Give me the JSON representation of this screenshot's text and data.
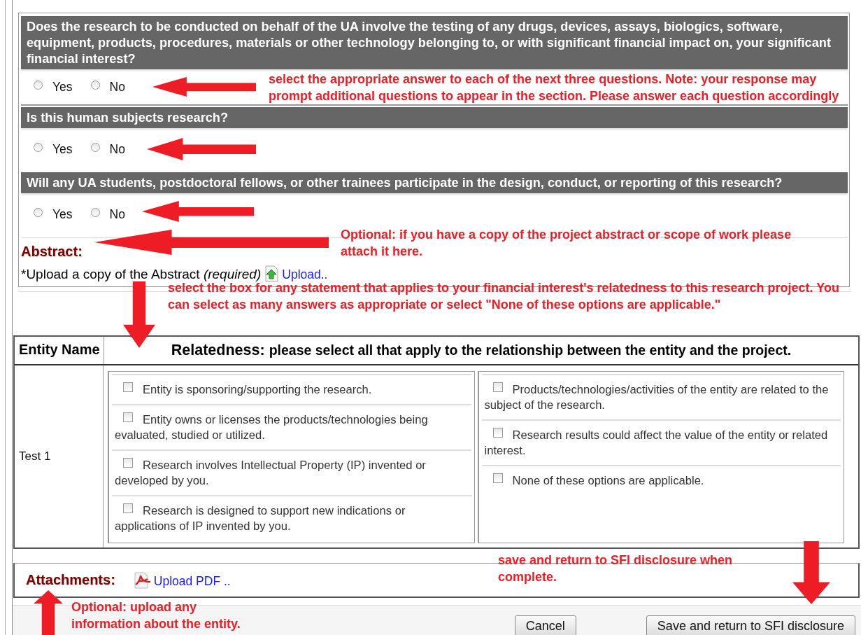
{
  "questions": [
    {
      "text": "Does the research to be conducted on behalf of the UA involve the testing of any drugs, devices, assays, biologics, software, equipment, products, procedures, materials or other technology belonging to, or with significant financial impact on, your significant financial interest?",
      "options": [
        {
          "label": "Yes",
          "selected": false
        },
        {
          "label": "No",
          "selected": false
        }
      ]
    },
    {
      "text": "Is this human subjects research?",
      "options": [
        {
          "label": "Yes",
          "selected": false
        },
        {
          "label": "No",
          "selected": false
        }
      ]
    },
    {
      "text": "Will any UA students, postdoctoral fellows, or other trainees participate in the design, conduct, or reporting of this research?",
      "options": [
        {
          "label": "Yes",
          "selected": false
        },
        {
          "label": "No",
          "selected": false
        }
      ]
    }
  ],
  "abstract": {
    "label": "Abstract:",
    "upload_text": "*Upload a copy of the Abstract *(required)*",
    "link": "Upload.."
  },
  "relatedness_table": {
    "entity_header": "Entity Name",
    "relatedness_label": "Relatedness:",
    "relatedness_text": "please select all that apply to the relationship between the entity and the project.",
    "rows": [
      {
        "entity": "Test 1",
        "left_options": [
          {
            "label": "Entity is sponsoring/supporting the research.",
            "checked": false
          },
          {
            "label": "Entity owns or licenses the products/technologies being evaluated, studied or utilized.",
            "checked": false
          },
          {
            "label": "Research involves Intellectual Property (IP) invented or developed by you.",
            "checked": false
          },
          {
            "label": "Research is designed to support new indications or applications of IP invented by you.",
            "checked": false
          }
        ],
        "right_options": [
          {
            "label": "Products/technologies/activities of the entity are related to the subject of the research.",
            "checked": false
          },
          {
            "label": "Research results could affect the value of the entity or related interest.",
            "checked": false
          },
          {
            "label": "None of these options are applicable.",
            "checked": false
          }
        ]
      }
    ]
  },
  "attachments": {
    "label": "Attachments:",
    "link": "Upload PDF .."
  },
  "buttons": [
    "Cancel",
    "Save and return to SFI disclosure"
  ],
  "annotations": [
    {
      "text": "select the appropriate answer to each of the next three questions.  Note: your response may prompt additional questions to appear in the section.  Please answer each question accordingly"
    },
    {
      "text": "Optional: if you have a copy of the project abstract or scope of work please attach it here."
    },
    {
      "text": "select the box for any statement that applies to your financial interest's relatedness to this research project. You can select as many answers as appropriate or select \"None of these options are applicable.\""
    },
    {
      "text": "save and return to SFI disclosure when complete."
    },
    {
      "text": "Optional: upload any information about the entity."
    }
  ]
}
